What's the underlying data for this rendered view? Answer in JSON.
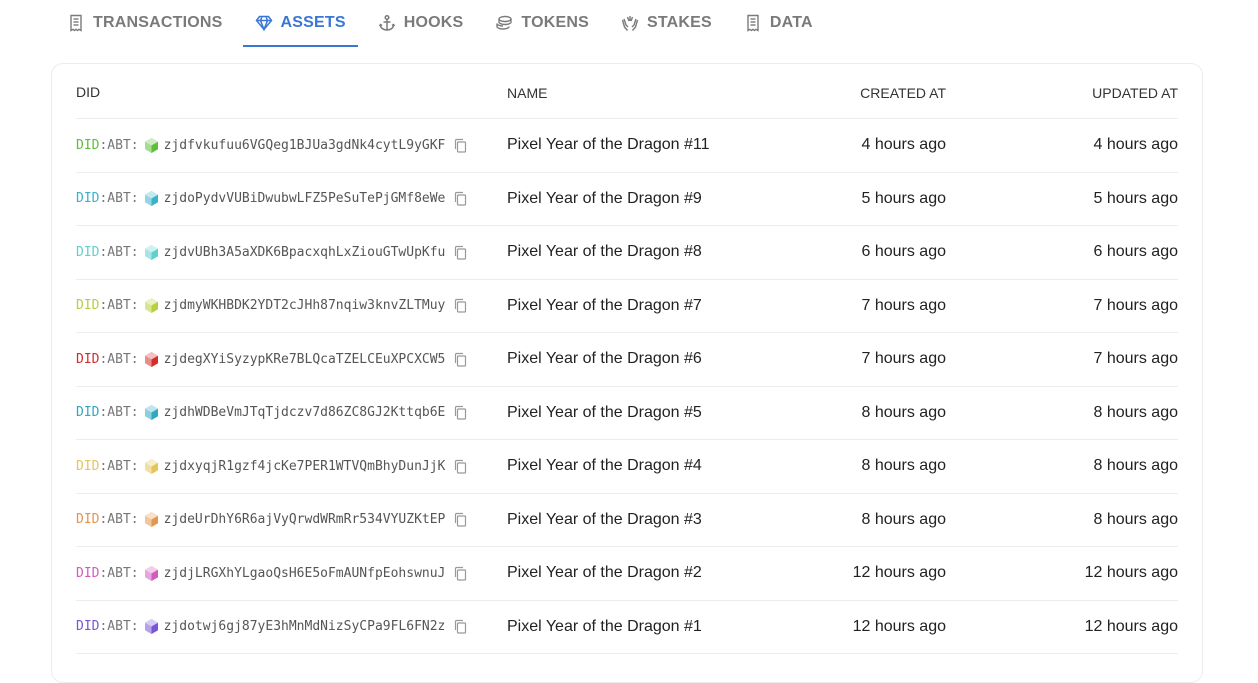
{
  "tabs": [
    {
      "label": "TRANSACTIONS",
      "icon": "receipt-icon",
      "active": false
    },
    {
      "label": "ASSETS",
      "icon": "diamond-icon",
      "active": true
    },
    {
      "label": "HOOKS",
      "icon": "anchor-icon",
      "active": false
    },
    {
      "label": "TOKENS",
      "icon": "coins-icon",
      "active": false
    },
    {
      "label": "STAKES",
      "icon": "hands-icon",
      "active": false
    },
    {
      "label": "DATA",
      "icon": "receipt-icon",
      "active": false
    }
  ],
  "table": {
    "headers": {
      "did": "DID",
      "name": "NAME",
      "created": "CREATED AT",
      "updated": "UPDATED AT"
    },
    "did_prefix": "DID",
    "did_sep": ":ABT:",
    "rows": [
      {
        "addr": "zjdfvkufuu6VGQeg1BJUa3gdNk4cytL9yGKF",
        "name": "Pixel Year of the Dragon #11",
        "created": "4 hours ago",
        "updated": "4 hours ago",
        "color": "#5fbf3b"
      },
      {
        "addr": "zjdoPydvVUBiDwubwLFZ5PeSuTePjGMf8eWe",
        "name": "Pixel Year of the Dragon #9",
        "created": "5 hours ago",
        "updated": "5 hours ago",
        "color": "#3ab2c9"
      },
      {
        "addr": "zjdvUBh3A5aXDK6BpacxqhLxZiouGTwUpKfu",
        "name": "Pixel Year of the Dragon #8",
        "created": "6 hours ago",
        "updated": "6 hours ago",
        "color": "#5fcfd0"
      },
      {
        "addr": "zjdmyWKHBDK2YDT2cJHh87nqiw3knvZLTMuy",
        "name": "Pixel Year of the Dragon #7",
        "created": "7 hours ago",
        "updated": "7 hours ago",
        "color": "#b9cf3b"
      },
      {
        "addr": "zjdegXYiSyzypKRe7BLQcaTZELCEuXPCXCW5",
        "name": "Pixel Year of the Dragon #6",
        "created": "7 hours ago",
        "updated": "7 hours ago",
        "color": "#d42c2c"
      },
      {
        "addr": "zjdhWDBeVmJTqTjdczv7d86ZC8GJ2Kttqb6E",
        "name": "Pixel Year of the Dragon #5",
        "created": "8 hours ago",
        "updated": "8 hours ago",
        "color": "#2fa8c0"
      },
      {
        "addr": "zjdxyqjR1gzf4jcKe7PER1WTVQmBhyDunJjK",
        "name": "Pixel Year of the Dragon #4",
        "created": "8 hours ago",
        "updated": "8 hours ago",
        "color": "#e5c55c"
      },
      {
        "addr": "zjdeUrDhY6R6ajVyQrwdWRmRr534VYUZKtEP",
        "name": "Pixel Year of the Dragon #3",
        "created": "8 hours ago",
        "updated": "8 hours ago",
        "color": "#e6954d"
      },
      {
        "addr": "zjdjLRGXhYLgaoQsH6E5oFmAUNfpEohswnuJ",
        "name": "Pixel Year of the Dragon #2",
        "created": "12 hours ago",
        "updated": "12 hours ago",
        "color": "#d45bbd"
      },
      {
        "addr": "zjdotwj6gj87yE3hMnMdNizSyCPa9FL6FN2z",
        "name": "Pixel Year of the Dragon #1",
        "created": "12 hours ago",
        "updated": "12 hours ago",
        "color": "#7a55d6"
      }
    ]
  },
  "colors": {
    "accent": "#3a76d4",
    "tab_inactive": "#7a7a7a"
  }
}
